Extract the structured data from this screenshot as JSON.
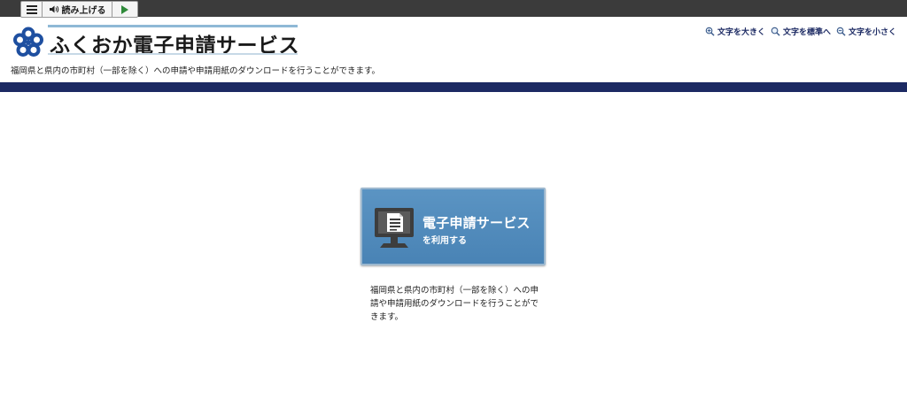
{
  "toolbar": {
    "menu_icon": "hamburger-menu-icon",
    "speaker_icon": "speaker-icon",
    "read_aloud_label": "読み上げる",
    "play_icon": "play-icon"
  },
  "header": {
    "logo_text": "ふくおか電子申請サービス",
    "logo_icon": "fukuoka-plum-logo-icon",
    "subtitle": "福岡県と県内の市町村（一部を除く）への申請や申請用紙のダウンロードを行うことができます。",
    "font_size_controls": [
      {
        "label": "文字を大きく",
        "icon": "zoom-in-icon"
      },
      {
        "label": "文字を標準へ",
        "icon": "zoom-reset-icon"
      },
      {
        "label": "文字を小さく",
        "icon": "zoom-out-icon"
      }
    ]
  },
  "main": {
    "button_title": "電子申請サービス",
    "button_subtitle": "を利用する",
    "button_icon": "monitor-document-icon",
    "description": "福岡県と県内の市町村（一部を除く）への申請や申請用紙のダウンロードを行うことができます。"
  },
  "colors": {
    "top_bar": "#3b3b3b",
    "navy_band": "#1c2a63",
    "button_blue": "#5b94c3",
    "logo_blue": "#1e4fa0"
  }
}
